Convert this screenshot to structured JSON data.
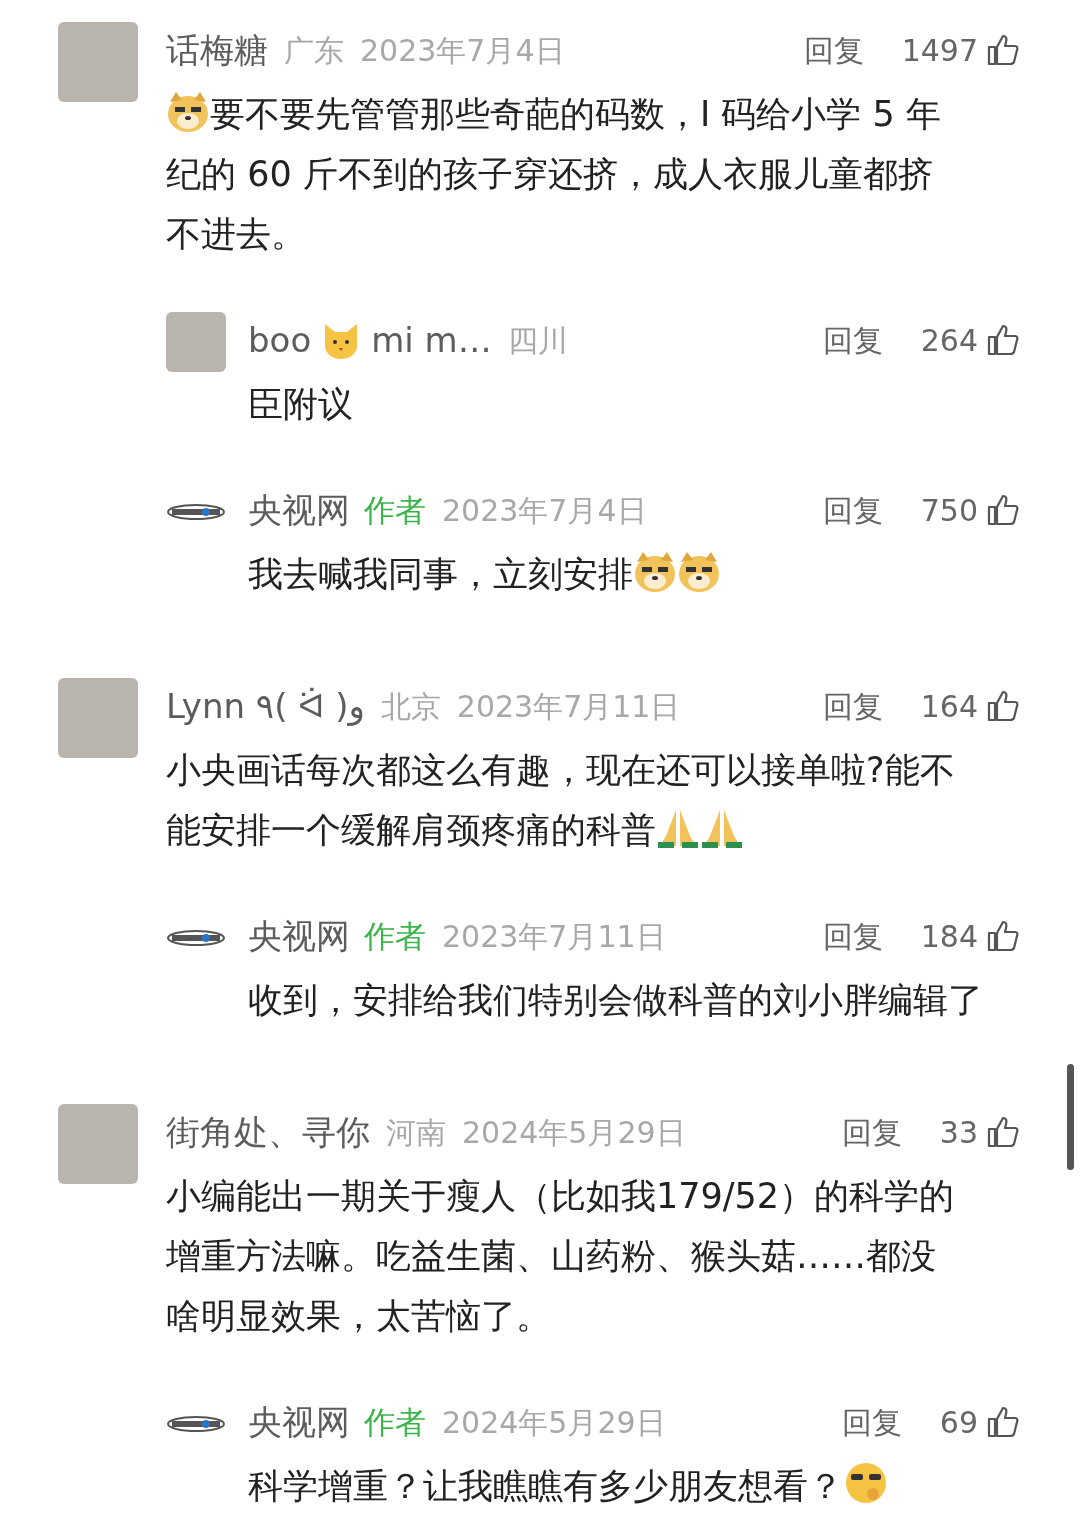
{
  "comments": [
    {
      "avatar": {
        "kind": "photo"
      },
      "name": [
        {
          "kind": "text",
          "text": "话梅糖"
        }
      ],
      "location": "广东",
      "date": "2023年7月4日",
      "reply": "回复",
      "likes": "1497",
      "body": [
        {
          "kind": "doge-emoji"
        },
        {
          "kind": "text",
          "text": "要不要先管管那些奇葩的码数，I 码给小学 5 年纪的 60 斤不到的孩子穿还挤，成人衣服儿童都挤不进去。"
        }
      ],
      "children": [
        {
          "avatar": {
            "kind": "photo"
          },
          "name": [
            {
              "kind": "text",
              "text": "boo"
            },
            {
              "kind": "cat-emoji"
            },
            {
              "kind": "text",
              "text": "mi m…"
            }
          ],
          "location": "四川",
          "reply": "回复",
          "likes": "264",
          "body": [
            {
              "kind": "text",
              "text": "臣附议"
            }
          ]
        },
        {
          "avatar": {
            "kind": "logo"
          },
          "name": [
            {
              "kind": "text",
              "text": "央视网"
            }
          ],
          "author_tag": "作者",
          "date": "2023年7月4日",
          "reply": "回复",
          "likes": "750",
          "body": [
            {
              "kind": "text",
              "text": "我去喊我同事，立刻安排"
            },
            {
              "kind": "doge-emoji"
            },
            {
              "kind": "doge-emoji"
            }
          ]
        }
      ]
    },
    {
      "avatar": {
        "kind": "photo"
      },
      "name": [
        {
          "kind": "text",
          "text": "Lynn ٩( ᐛ )و"
        }
      ],
      "location": "北京",
      "date": "2023年7月11日",
      "reply": "回复",
      "likes": "164",
      "body": [
        {
          "kind": "text",
          "text": "小央画话每次都这么有趣，现在还可以接单啦?能不能安排一个缓解肩颈疼痛的科普"
        },
        {
          "kind": "pray-emoji"
        },
        {
          "kind": "pray-emoji"
        }
      ],
      "children": [
        {
          "avatar": {
            "kind": "logo"
          },
          "name": [
            {
              "kind": "text",
              "text": "央视网"
            }
          ],
          "author_tag": "作者",
          "date": "2023年7月11日",
          "reply": "回复",
          "likes": "184",
          "body": [
            {
              "kind": "text",
              "text": "收到，安排给我们特别会做科普的刘小胖编辑了"
            }
          ]
        }
      ]
    },
    {
      "avatar": {
        "kind": "photo"
      },
      "name": [
        {
          "kind": "text",
          "text": "街角处、寻你"
        }
      ],
      "location": "河南",
      "date": "2024年5月29日",
      "reply": "回复",
      "likes": "33",
      "body": [
        {
          "kind": "text",
          "text": "小编能出一期关于瘦人（比如我179/52）的科学的增重方法嘛。吃益生菌、山药粉、猴头菇……都没啥明显效果，太苦恼了。"
        }
      ],
      "children": [
        {
          "avatar": {
            "kind": "logo"
          },
          "name": [
            {
              "kind": "text",
              "text": "央视网"
            }
          ],
          "author_tag": "作者",
          "date": "2024年5月29日",
          "reply": "回复",
          "likes": "69",
          "body": [
            {
              "kind": "text",
              "text": "科学增重？让我瞧瞧有多少朋友想看？"
            },
            {
              "kind": "glasses-emoji"
            }
          ]
        }
      ]
    }
  ]
}
